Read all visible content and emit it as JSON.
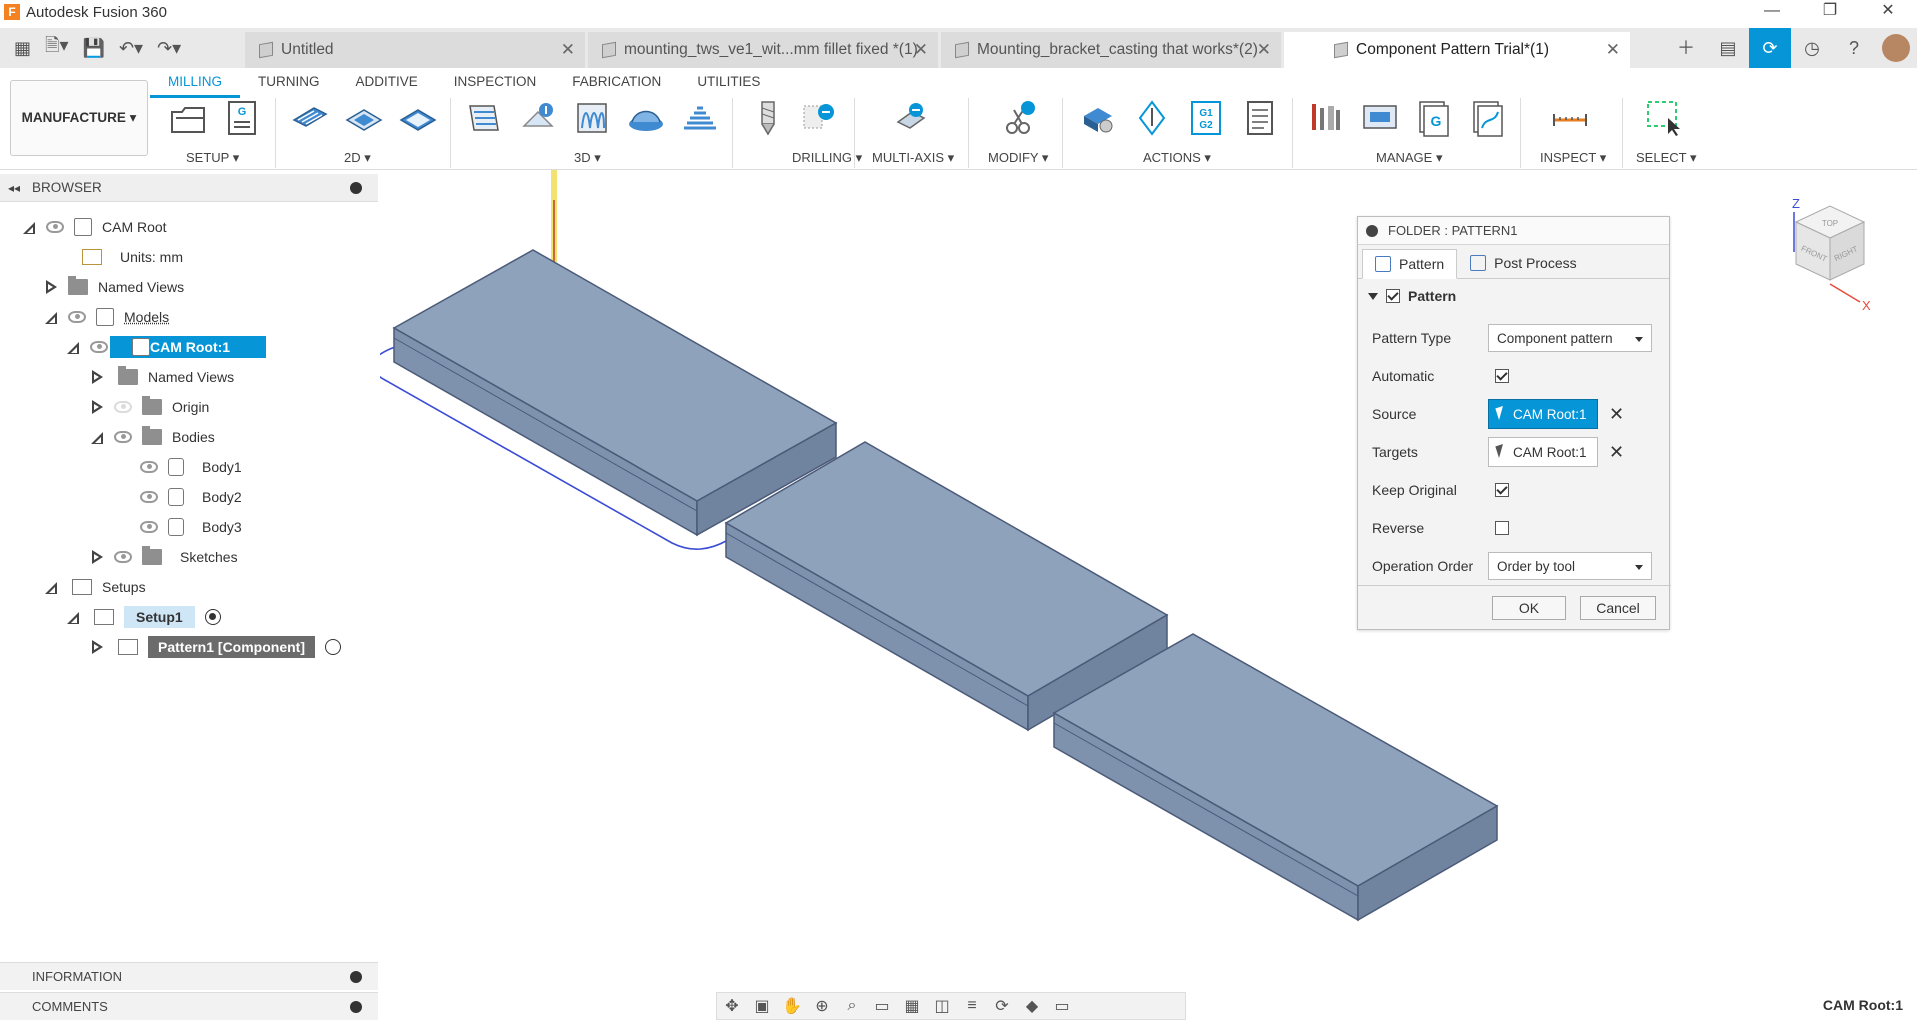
{
  "app": {
    "title": "Autodesk Fusion 360",
    "logo": "F"
  },
  "doc_tabs": [
    {
      "label": "Untitled",
      "active": false
    },
    {
      "label": "mounting_tws_ve1_wit...mm fillet fixed *(1)",
      "active": false
    },
    {
      "label": "Mounting_bracket_casting that works*(2)",
      "active": false
    },
    {
      "label": "Component Pattern Trial*(1)",
      "active": true
    }
  ],
  "ribbon": {
    "workspace": "MANUFACTURE ▾",
    "tabs": [
      "MILLING",
      "TURNING",
      "ADDITIVE",
      "INSPECTION",
      "FABRICATION",
      "UTILITIES"
    ],
    "active_tab": "MILLING",
    "groups": [
      "SETUP ▾",
      "2D ▾",
      "3D ▾",
      "DRILLING ▾",
      "MULTI-AXIS ▾",
      "MODIFY ▾",
      "ACTIONS ▾",
      "MANAGE ▾",
      "INSPECT ▾",
      "SELECT ▾"
    ],
    "g1g2": "G1\nG2",
    "g_label": "G"
  },
  "browser": {
    "title": "BROWSER",
    "items": {
      "cam_root": "CAM Root",
      "units": "Units: mm",
      "named_views": "Named Views",
      "models": "Models",
      "cam_root_1": "CAM Root:1",
      "named_views_2": "Named Views",
      "origin": "Origin",
      "bodies": "Bodies",
      "body1": "Body1",
      "body2": "Body2",
      "body3": "Body3",
      "sketches": "Sketches",
      "setups": "Setups",
      "setup1": "Setup1",
      "pattern1": "Pattern1 [Component]"
    }
  },
  "bottom_panels": {
    "information": "INFORMATION",
    "comments": "COMMENTS"
  },
  "dialog": {
    "title": "FOLDER : PATTERN1",
    "tabs": [
      "Pattern",
      "Post Process"
    ],
    "section": "Pattern",
    "fields": {
      "pattern_type_label": "Pattern Type",
      "pattern_type_value": "Component pattern",
      "automatic_label": "Automatic",
      "source_label": "Source",
      "source_value": "CAM Root:1",
      "targets_label": "Targets",
      "targets_value": "CAM Root:1",
      "keep_original_label": "Keep Original",
      "reverse_label": "Reverse",
      "operation_order_label": "Operation Order",
      "operation_order_value": "Order by tool"
    },
    "ok": "OK",
    "cancel": "Cancel"
  },
  "viewcube": {
    "z": "Z",
    "x": "X",
    "top": "TOP",
    "front": "FRONT",
    "right": "RIGHT"
  },
  "status": {
    "selection": "CAM Root:1"
  },
  "colors": {
    "accent": "#0696d7",
    "body_top": "#8fa2bc",
    "body_side": "#7d91ad",
    "body_edge": "#4a5a78"
  }
}
